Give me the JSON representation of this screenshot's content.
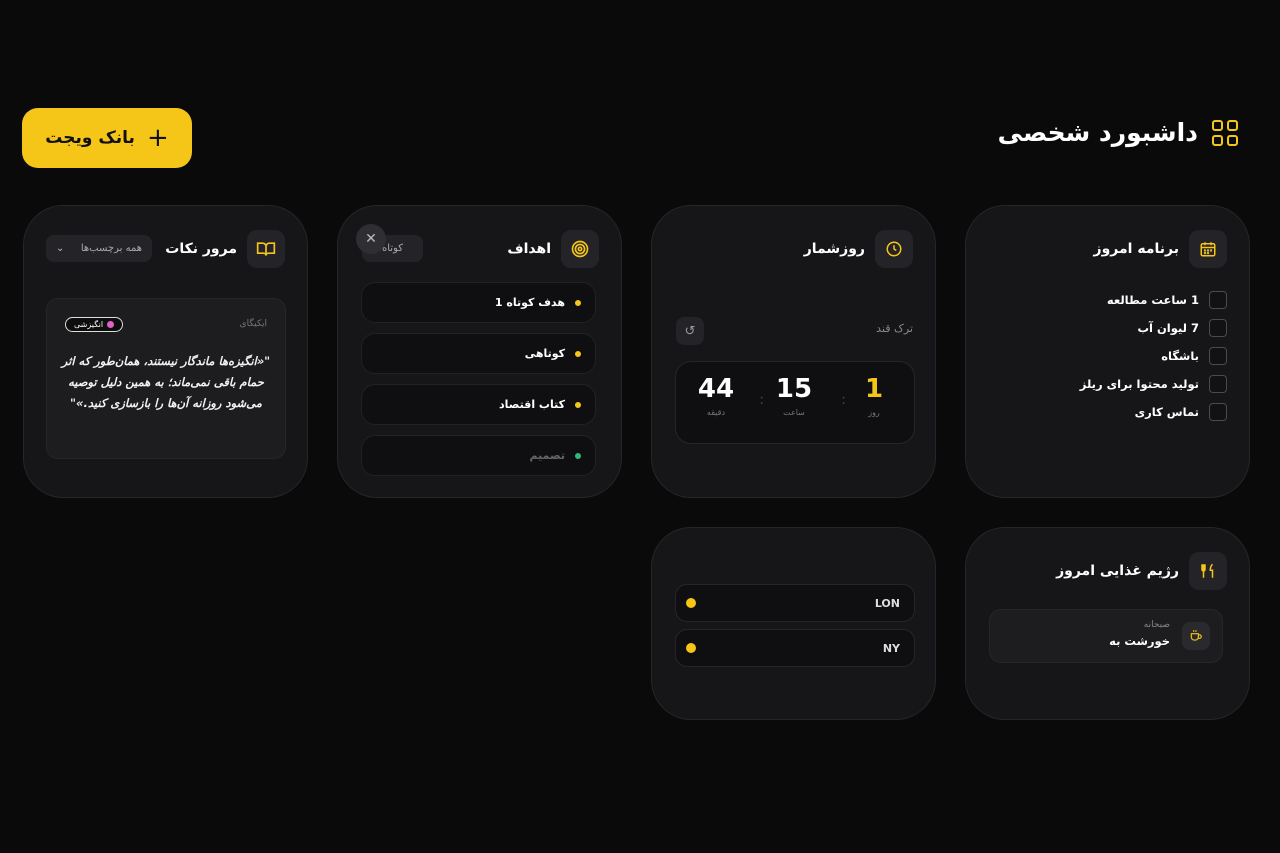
{
  "header": {
    "title": "داشبورد شخصی",
    "icon": "grid-icon"
  },
  "bank_button": {
    "label": "بانک ویجت",
    "icon": "plus-icon"
  },
  "colors": {
    "accent": "#f5c518",
    "background": "#0a0a0b",
    "card": "#161618"
  },
  "notes": {
    "title": "مرور نکات",
    "tag_filter": "همه برچسب‌ها",
    "note": {
      "source": "ایکیگای",
      "tag": "انگیزشی",
      "text": "\"«انگیزه‌ها ماندگار نیستند، همان‌طور که اثر حمام باقی نمی‌ماند؛ به همین دلیل توصیه می‌شود روزانه آن‌ها را بازسازی کنید.»\""
    }
  },
  "goals": {
    "title": "اهداف",
    "filter": "کوتاه",
    "items": [
      {
        "label": "هدف کوتاه 1"
      },
      {
        "label": "کوتاهی"
      },
      {
        "label": "کتاب اقتصاد"
      },
      {
        "label": "تصمیم"
      }
    ]
  },
  "countdown": {
    "title": "روزشمار",
    "label": "ترک قند",
    "units": [
      {
        "value": "1",
        "caption": "روز"
      },
      {
        "value": "15",
        "caption": "ساعت"
      },
      {
        "value": "44",
        "caption": "دقیقه"
      }
    ],
    "separator": ":"
  },
  "today": {
    "title": "برنامه امروز",
    "tasks": [
      {
        "label": "1 ساعت مطالعه",
        "checked": false
      },
      {
        "label": "7 لیوان آب",
        "checked": false
      },
      {
        "label": "باشگاه",
        "checked": false
      },
      {
        "label": "تولید محتوا برای ریلز",
        "checked": false
      },
      {
        "label": "تماس کاری",
        "checked": false
      }
    ]
  },
  "clocks": {
    "cities": [
      "LON",
      "NY"
    ]
  },
  "diet": {
    "title": "رژیم غذایی امروز",
    "meal": {
      "type": "صبحانه",
      "name": "خورشت به"
    }
  }
}
